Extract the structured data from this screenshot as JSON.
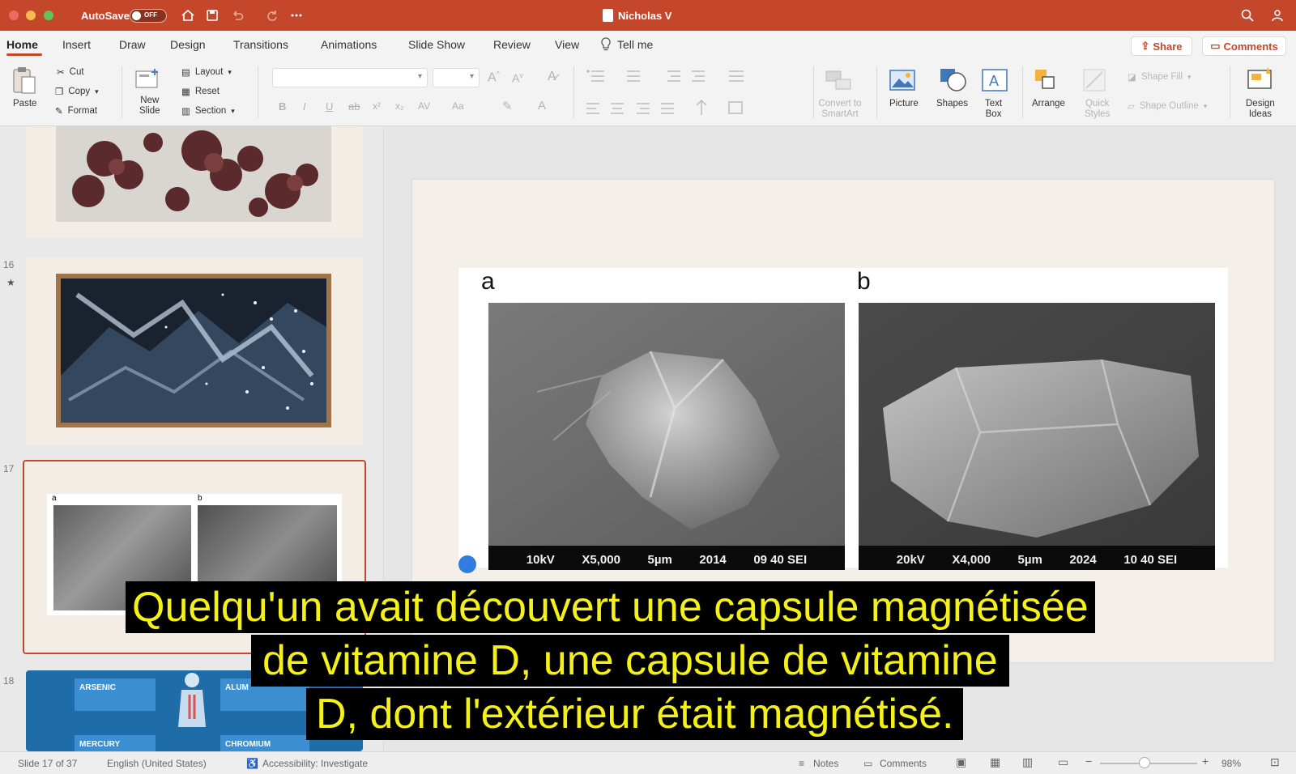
{
  "titlebar": {
    "autosave_label": "AutoSave",
    "autosave_state": "OFF",
    "document_title": "Nicholas V",
    "accent_color": "#c4472c"
  },
  "tabs": [
    "Home",
    "Insert",
    "Draw",
    "Design",
    "Transitions",
    "Animations",
    "Slide Show",
    "Review",
    "View",
    "Tell me"
  ],
  "active_tab": "Home",
  "top_right": {
    "share": "Share",
    "comments": "Comments"
  },
  "ribbon": {
    "paste": "Paste",
    "cut": "Cut",
    "copy": "Copy",
    "format": "Format",
    "new_slide": [
      "New",
      "Slide"
    ],
    "layout": "Layout",
    "reset": "Reset",
    "section": "Section",
    "convert_smartart": [
      "Convert to",
      "SmartArt"
    ],
    "picture": "Picture",
    "shapes": "Shapes",
    "text_box": [
      "Text",
      "Box"
    ],
    "arrange": "Arrange",
    "quick_styles": [
      "Quick",
      "Styles"
    ],
    "shape_fill": "Shape Fill",
    "shape_outline": "Shape Outline",
    "design_ideas": [
      "Design",
      "Ideas"
    ],
    "format_buttons": [
      "B",
      "I",
      "U",
      "ab",
      "x²",
      "x₂",
      "AV",
      "Aa"
    ]
  },
  "thumbnails": {
    "numbers": [
      "16",
      "17",
      "18"
    ],
    "slide17_labels": [
      "a",
      "b"
    ],
    "slide18_texts": [
      "ARSENIC",
      "ALUM",
      "MERCURY",
      "CHROMIUM"
    ]
  },
  "slide": {
    "label_a": "a",
    "label_b": "b",
    "sem_a": [
      "10kV",
      "X5,000",
      "5µm",
      "2014",
      "09 40 SEI"
    ],
    "sem_b": [
      "20kV",
      "X4,000",
      "5µm",
      "2024",
      "10 40 SEI"
    ]
  },
  "subtitle": {
    "lines": [
      "Quelqu'un avait découvert une capsule magnétisée",
      "de vitamine D, une capsule de vitamine",
      "D, dont l'extérieur était magnétisé."
    ],
    "text_color": "#f4f01a"
  },
  "statusbar": {
    "slide_info": "Slide 17 of 37",
    "language": "English (United States)",
    "accessibility": "Accessibility: Investigate",
    "notes": "Notes",
    "comments": "Comments",
    "zoom": "98%"
  }
}
